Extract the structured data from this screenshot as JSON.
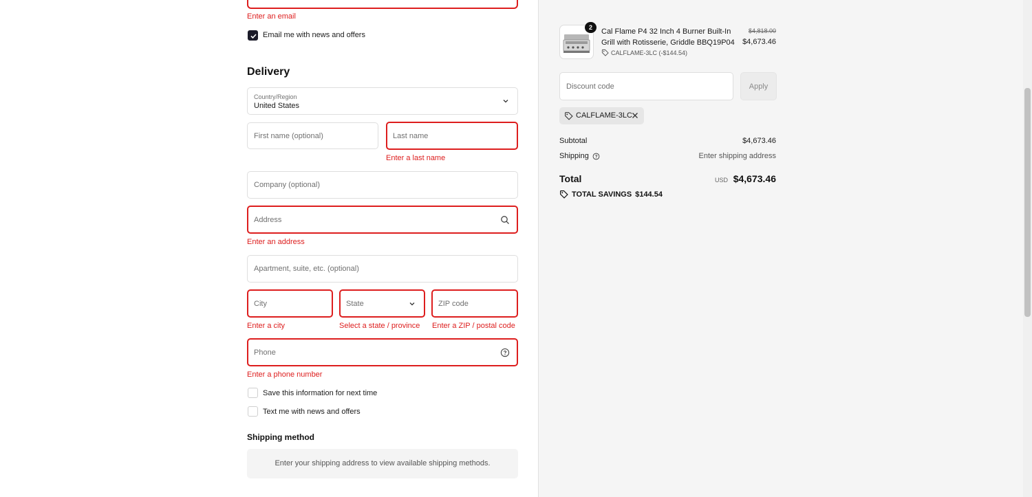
{
  "contact": {
    "email_error": "Enter an email",
    "email_news_label": "Email me with news and offers",
    "email_news_checked": true
  },
  "delivery": {
    "heading": "Delivery",
    "country_label": "Country/Region",
    "country_value": "United States",
    "first_name_placeholder": "First name (optional)",
    "last_name_placeholder": "Last name",
    "last_name_error": "Enter a last name",
    "company_placeholder": "Company (optional)",
    "address_placeholder": "Address",
    "address_error": "Enter an address",
    "apartment_placeholder": "Apartment, suite, etc. (optional)",
    "city_placeholder": "City",
    "city_error": "Enter a city",
    "state_placeholder": "State",
    "state_error": "Select a state / province",
    "zip_placeholder": "ZIP code",
    "zip_error": "Enter a ZIP / postal code",
    "phone_placeholder": "Phone",
    "phone_error": "Enter a phone number",
    "save_info_label": "Save this information for next time",
    "text_news_label": "Text me with news and offers"
  },
  "shipping_method": {
    "heading": "Shipping method",
    "message": "Enter your shipping address to view available shipping methods."
  },
  "summary": {
    "product": {
      "quantity": "2",
      "name": "Cal Flame P4 32 Inch 4 Burner Built-In Grill with Rotisserie, Griddle BBQ19P04",
      "discount_line": "CALFLAME-3LC (-$144.54)",
      "original_price": "$4,818.00",
      "price": "$4,673.46"
    },
    "discount_placeholder": "Discount code",
    "apply_label": "Apply",
    "applied_code": "CALFLAME-3LC",
    "subtotal_label": "Subtotal",
    "subtotal_value": "$4,673.46",
    "shipping_label": "Shipping",
    "shipping_value": "Enter shipping address",
    "total_label": "Total",
    "total_currency": "USD",
    "total_value": "$4,673.46",
    "savings_label": "TOTAL SAVINGS",
    "savings_value": "$144.54"
  },
  "colors": {
    "error": "#dd1d1d",
    "checkbox_checked": "#1c1c2a",
    "summary_bg": "#f5f5f5"
  }
}
